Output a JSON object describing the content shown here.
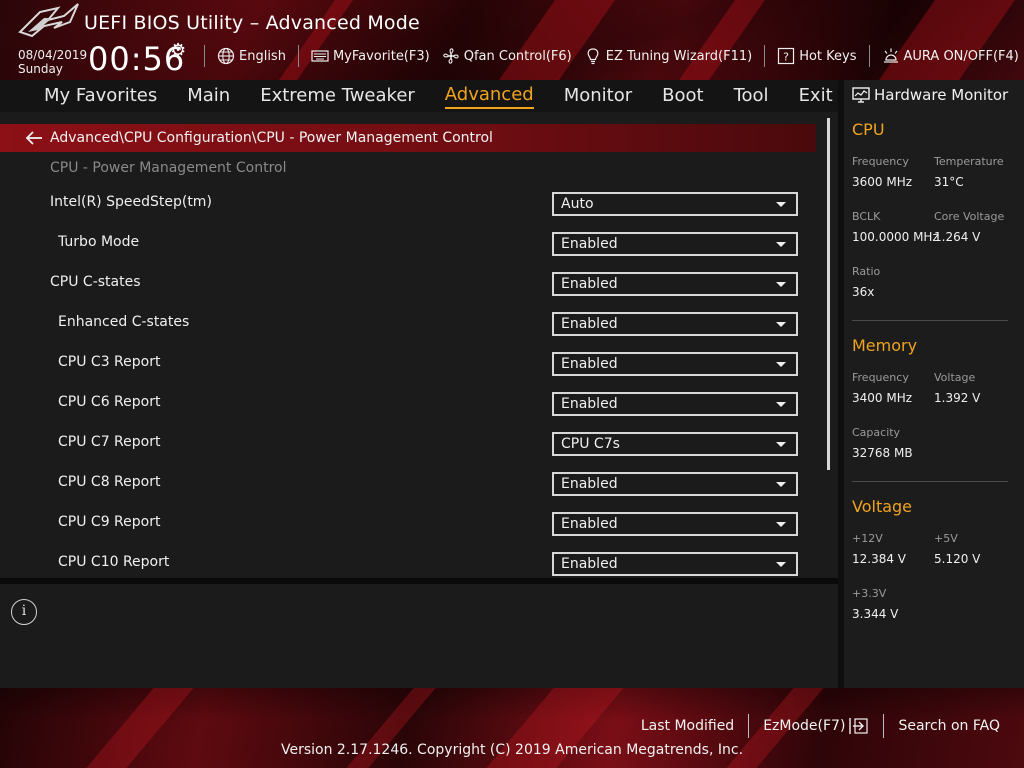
{
  "header": {
    "title": "UEFI BIOS Utility – Advanced Mode",
    "date": "08/04/2019",
    "day": "Sunday",
    "time": "00:56",
    "toolbar": [
      {
        "label": "English",
        "icon": "globe-icon"
      },
      {
        "label": "MyFavorite(F3)",
        "icon": "keyboard-icon"
      },
      {
        "label": "Qfan Control(F6)",
        "icon": "fan-icon"
      },
      {
        "label": "EZ Tuning Wizard(F11)",
        "icon": "lightbulb-icon"
      },
      {
        "label": "Hot Keys",
        "icon": "question-box-icon"
      },
      {
        "label": "AURA ON/OFF(F4)",
        "icon": "aura-light-icon"
      }
    ]
  },
  "nav": {
    "items": [
      "My Favorites",
      "Main",
      "Extreme Tweaker",
      "Advanced",
      "Monitor",
      "Boot",
      "Tool",
      "Exit"
    ],
    "active": "Advanced"
  },
  "content": {
    "breadcrumb": "Advanced\\CPU Configuration\\CPU - Power Management Control",
    "section_title": "CPU - Power Management Control",
    "settings": [
      {
        "label": "Intel(R) SpeedStep(tm)",
        "value": "Auto"
      },
      {
        "label": "Turbo Mode",
        "value": "Enabled"
      },
      {
        "label": "CPU C-states",
        "value": "Enabled"
      },
      {
        "label": "Enhanced C-states",
        "value": "Enabled"
      },
      {
        "label": "CPU C3 Report",
        "value": "Enabled"
      },
      {
        "label": "CPU C6 Report",
        "value": "Enabled"
      },
      {
        "label": "CPU C7 Report",
        "value": "CPU C7s"
      },
      {
        "label": "CPU C8 Report",
        "value": "Enabled"
      },
      {
        "label": "CPU C9 Report",
        "value": "Enabled"
      },
      {
        "label": "CPU C10 Report",
        "value": "Enabled"
      }
    ]
  },
  "hardware_monitor": {
    "title": "Hardware Monitor",
    "cpu": {
      "heading": "CPU",
      "frequency_label": "Frequency",
      "frequency": "3600 MHz",
      "temperature_label": "Temperature",
      "temperature": "31°C",
      "bclk_label": "BCLK",
      "bclk": "100.0000 MHz",
      "core_voltage_label": "Core Voltage",
      "core_voltage": "1.264 V",
      "ratio_label": "Ratio",
      "ratio": "36x"
    },
    "memory": {
      "heading": "Memory",
      "frequency_label": "Frequency",
      "frequency": "3400 MHz",
      "voltage_label": "Voltage",
      "voltage": "1.392 V",
      "capacity_label": "Capacity",
      "capacity": "32768 MB"
    },
    "voltage": {
      "heading": "Voltage",
      "v12_label": "+12V",
      "v12": "12.384 V",
      "v5_label": "+5V",
      "v5": "5.120 V",
      "v33_label": "+3.3V",
      "v33": "3.344 V"
    }
  },
  "footer": {
    "last_modified": "Last Modified",
    "ezmode": "EzMode(F7)",
    "search_faq": "Search on FAQ",
    "copyright": "Version 2.17.1246. Copyright (C) 2019 American Megatrends, Inc."
  },
  "colors": {
    "accent": "#f0a31e",
    "breadcrumb_red": "#8c1016",
    "panel_bg": "#1b1b1b"
  }
}
